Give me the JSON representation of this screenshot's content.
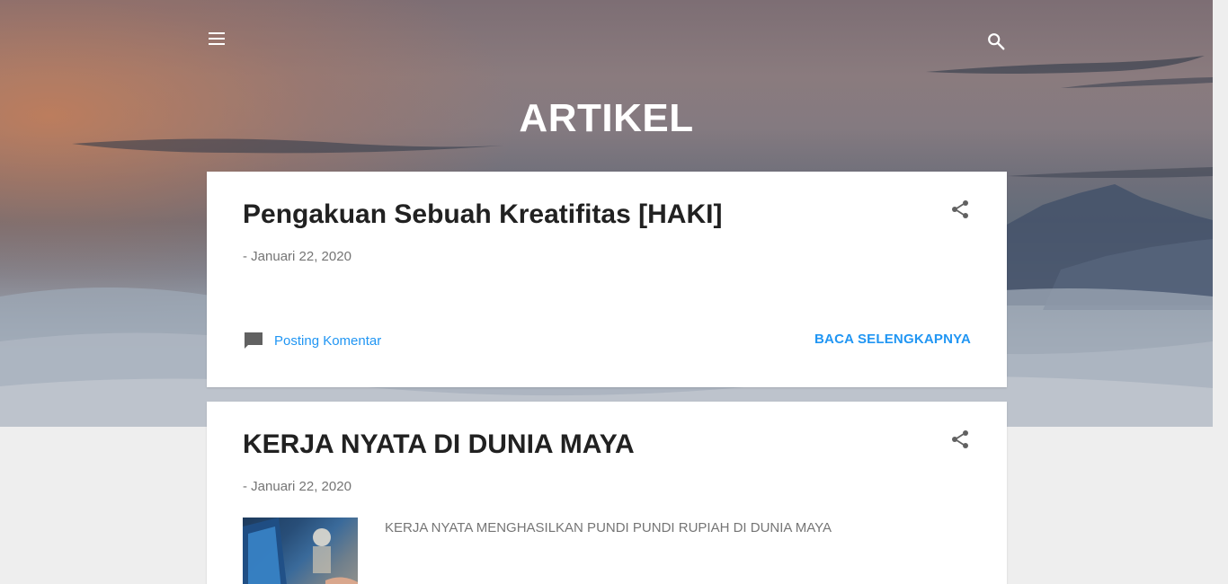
{
  "header": {
    "blog_title": "ARTIKEL",
    "menu_icon": "menu-icon",
    "search_icon": "search-icon"
  },
  "posts": [
    {
      "title": "Pengakuan Sebuah Kreatifitas [HAKI]",
      "date": "- Januari 22, 2020",
      "comment_label": "Posting Komentar",
      "read_more_label": "BACA SELENGKAPNYA"
    },
    {
      "title": "KERJA NYATA DI DUNIA MAYA",
      "date": "- Januari 22, 2020",
      "snippet": "KERJA NYATA MENGHASILKAN PUNDI PUNDI RUPIAH DI DUNIA MAYA"
    }
  ],
  "colors": {
    "accent": "#2196f3",
    "title_text": "#212121",
    "meta_text": "#757575",
    "page_background": "#eeeeee"
  }
}
